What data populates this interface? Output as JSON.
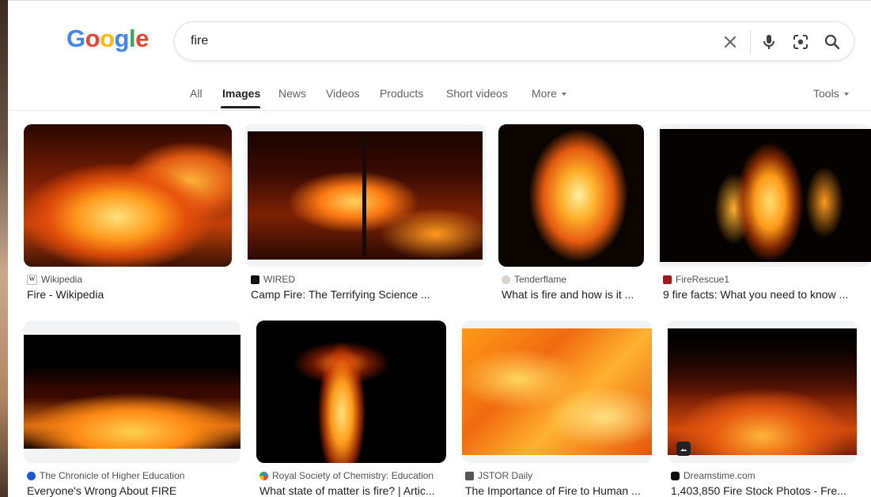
{
  "header": {
    "logo_letters": [
      "G",
      "o",
      "o",
      "g",
      "l",
      "e"
    ],
    "search": {
      "query": "fire"
    }
  },
  "tabs": [
    {
      "label": "All",
      "active": false
    },
    {
      "label": "Images",
      "active": true
    },
    {
      "label": "News",
      "active": false
    },
    {
      "label": "Videos",
      "active": false
    },
    {
      "label": "Products",
      "active": false
    },
    {
      "label": "Short videos",
      "active": false
    },
    {
      "label": "More",
      "active": false
    }
  ],
  "tools_label": "Tools",
  "results": [
    {
      "source": "Wikipedia",
      "title": "Fire - Wikipedia"
    },
    {
      "source": "WIRED",
      "title": "Camp Fire: The Terrifying Science ..."
    },
    {
      "source": "Tenderflame",
      "title": "What is fire and how is it ..."
    },
    {
      "source": "FireRescue1",
      "title": "9 fire facts: What you need to know ..."
    },
    {
      "source": "The Chronicle of Higher Education",
      "title": "Everyone's Wrong About FIRE"
    },
    {
      "source": "Royal Society of Chemistry: Education",
      "title": "What state of matter is fire? | Artic..."
    },
    {
      "source": "JSTOR Daily",
      "title": "The Importance of Fire to Human ..."
    },
    {
      "source": "Dreamstime.com",
      "title": "1,403,850 Fire Stock Photos - Fre..."
    }
  ],
  "colors": {
    "accent": "#1a73e8",
    "text": "#202124",
    "muted": "#5f6368"
  },
  "icons": [
    "clear-icon",
    "microphone-icon",
    "lens-camera-icon",
    "search-icon",
    "image-badge-icon"
  ]
}
